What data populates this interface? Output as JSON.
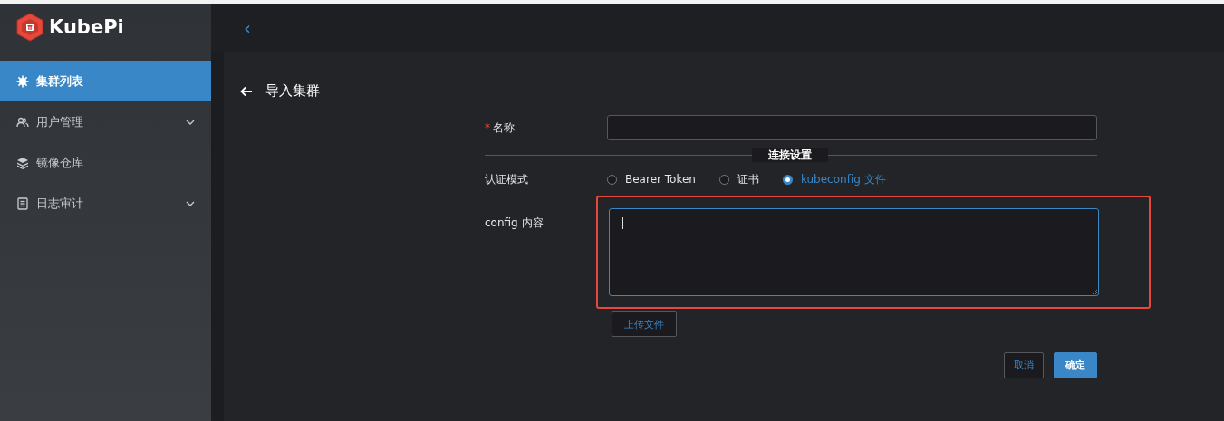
{
  "sidebar": {
    "logo": "KubePi",
    "items": [
      {
        "label": "集群列表",
        "selected": true,
        "expandable": false
      },
      {
        "label": "用户管理",
        "selected": false,
        "expandable": true
      },
      {
        "label": "镜像仓库",
        "selected": false,
        "expandable": false
      },
      {
        "label": "日志审计",
        "selected": false,
        "expandable": true
      }
    ]
  },
  "header": {
    "collapse": "‹"
  },
  "page": {
    "title": "导入集群"
  },
  "form": {
    "name": {
      "label": "名称",
      "required_mark": "*"
    },
    "section": "连接设置",
    "auth": {
      "label": "认证模式",
      "options": [
        {
          "label": "Bearer Token",
          "selected": false
        },
        {
          "label": "证书",
          "selected": false
        },
        {
          "label": "kubeconfig 文件",
          "selected": true
        }
      ]
    },
    "config": {
      "label": "config 内容",
      "highlighted": true,
      "focused": true
    },
    "upload": "上传文件",
    "buttons": [
      {
        "label": "取消",
        "kind": "secondary"
      },
      {
        "label": "确定",
        "kind": "primary"
      }
    ]
  }
}
